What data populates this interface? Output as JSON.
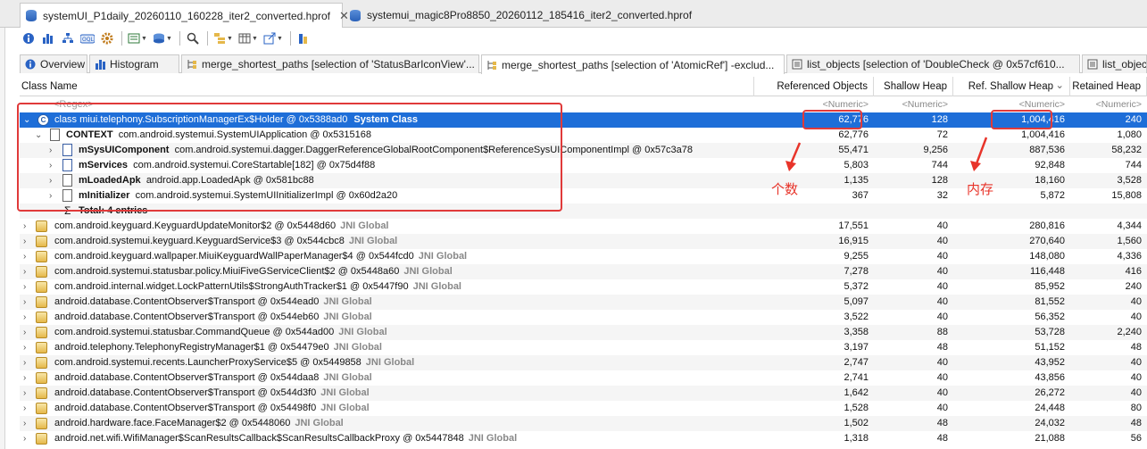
{
  "editor_tabs": [
    {
      "label": "systemUI_P1daily_20260110_160228_iter2_converted.hprof",
      "close": "✕",
      "active": true
    },
    {
      "label": "systemui_magic8Pro8850_20260112_185416_iter2_converted.hprof",
      "close": "",
      "active": false
    }
  ],
  "view_tabs": [
    {
      "label": "Overview",
      "active": false
    },
    {
      "label": "Histogram",
      "active": false
    },
    {
      "label": "merge_shortest_paths [selection of 'StatusBarIconView'...",
      "active": false
    },
    {
      "label": "merge_shortest_paths [selection of 'AtomicRef'] -exclud...",
      "active": true
    },
    {
      "label": "list_objects [selection of 'DoubleCheck @ 0x57cf610...",
      "active": false
    },
    {
      "label": "list_objects [s",
      "active": false
    }
  ],
  "columns": [
    "Class Name",
    "Referenced Objects",
    "Shallow Heap",
    "Ref. Shallow Heap",
    "Retained Heap"
  ],
  "sort_indicator": "⌄",
  "filter_row": {
    "regex": "<Regex>",
    "numeric": "<Numeric>"
  },
  "holder_row": {
    "name": "class miui.telephony.SubscriptionManagerEx$Holder @ 0x5388ad0",
    "tag": "System Class",
    "values": [
      "62,776",
      "128",
      "1,004,416",
      "240"
    ]
  },
  "child_rows": [
    {
      "field": "CONTEXT",
      "value": "com.android.systemui.SystemUIApplication @ 0x5315168",
      "values": [
        "62,776",
        "72",
        "1,004,416",
        "1,080"
      ]
    },
    {
      "field": "mSysUIComponent",
      "value": "com.android.systemui.dagger.DaggerReferenceGlobalRootComponent$ReferenceSysUIComponentImpl @ 0x57c3a78",
      "values": [
        "55,471",
        "9,256",
        "887,536",
        "58,232"
      ]
    },
    {
      "field": "mServices",
      "value": "com.android.systemui.CoreStartable[182] @ 0x75d4f88",
      "values": [
        "5,803",
        "744",
        "92,848",
        "744"
      ]
    },
    {
      "field": "mLoadedApk",
      "value": "android.app.LoadedApk @ 0x581bc88",
      "values": [
        "1,135",
        "128",
        "18,160",
        "3,528"
      ]
    },
    {
      "field": "mInitializer",
      "value": "com.android.systemui.SystemUIInitializerImpl @ 0x60d2a20",
      "values": [
        "367",
        "32",
        "5,872",
        "15,808"
      ]
    }
  ],
  "total_row": {
    "label": "Total: 4 entries"
  },
  "rows": [
    {
      "name": "com.android.keyguard.KeyguardUpdateMonitor$2 @ 0x5448d60",
      "tag": "JNI Global",
      "values": [
        "17,551",
        "40",
        "280,816",
        "4,344"
      ]
    },
    {
      "name": "com.android.systemui.keyguard.KeyguardService$3 @ 0x544cbc8",
      "tag": "JNI Global",
      "values": [
        "16,915",
        "40",
        "270,640",
        "1,560"
      ]
    },
    {
      "name": "com.android.keyguard.wallpaper.MiuiKeyguardWallPaperManager$4 @ 0x544fcd0",
      "tag": "JNI Global",
      "values": [
        "9,255",
        "40",
        "148,080",
        "4,336"
      ]
    },
    {
      "name": "com.android.systemui.statusbar.policy.MiuiFiveGServiceClient$2 @ 0x5448a60",
      "tag": "JNI Global",
      "values": [
        "7,278",
        "40",
        "116,448",
        "416"
      ]
    },
    {
      "name": "com.android.internal.widget.LockPatternUtils$StrongAuthTracker$1 @ 0x5447f90",
      "tag": "JNI Global",
      "values": [
        "5,372",
        "40",
        "85,952",
        "240"
      ]
    },
    {
      "name": "android.database.ContentObserver$Transport @ 0x544ead0",
      "tag": "JNI Global",
      "values": [
        "5,097",
        "40",
        "81,552",
        "40"
      ]
    },
    {
      "name": "android.database.ContentObserver$Transport @ 0x544eb60",
      "tag": "JNI Global",
      "values": [
        "3,522",
        "40",
        "56,352",
        "40"
      ]
    },
    {
      "name": "com.android.systemui.statusbar.CommandQueue @ 0x544ad00",
      "tag": "JNI Global",
      "values": [
        "3,358",
        "88",
        "53,728",
        "2,240"
      ]
    },
    {
      "name": "android.telephony.TelephonyRegistryManager$1 @ 0x54479e0",
      "tag": "JNI Global",
      "values": [
        "3,197",
        "48",
        "51,152",
        "48"
      ]
    },
    {
      "name": "com.android.systemui.recents.LauncherProxyService$5 @ 0x5449858",
      "tag": "JNI Global",
      "values": [
        "2,747",
        "40",
        "43,952",
        "40"
      ]
    },
    {
      "name": "android.database.ContentObserver$Transport @ 0x544daa8",
      "tag": "JNI Global",
      "values": [
        "2,741",
        "40",
        "43,856",
        "40"
      ]
    },
    {
      "name": "android.database.ContentObserver$Transport @ 0x544d3f0",
      "tag": "JNI Global",
      "values": [
        "1,642",
        "40",
        "26,272",
        "40"
      ]
    },
    {
      "name": "android.database.ContentObserver$Transport @ 0x54498f0",
      "tag": "JNI Global",
      "values": [
        "1,528",
        "40",
        "24,448",
        "80"
      ]
    },
    {
      "name": "android.hardware.face.FaceManager$2 @ 0x5448060",
      "tag": "JNI Global",
      "values": [
        "1,502",
        "48",
        "24,032",
        "48"
      ]
    },
    {
      "name": "android.net.wifi.WifiManager$ScanResultsCallback$ScanResultsCallbackProxy @ 0x5447848",
      "tag": "JNI Global",
      "values": [
        "1,318",
        "48",
        "21,088",
        "56"
      ]
    }
  ],
  "annotations": {
    "count_label": "个数",
    "memory_label": "内存",
    "color": "#e8342a"
  },
  "accent": "#1e6ed8"
}
